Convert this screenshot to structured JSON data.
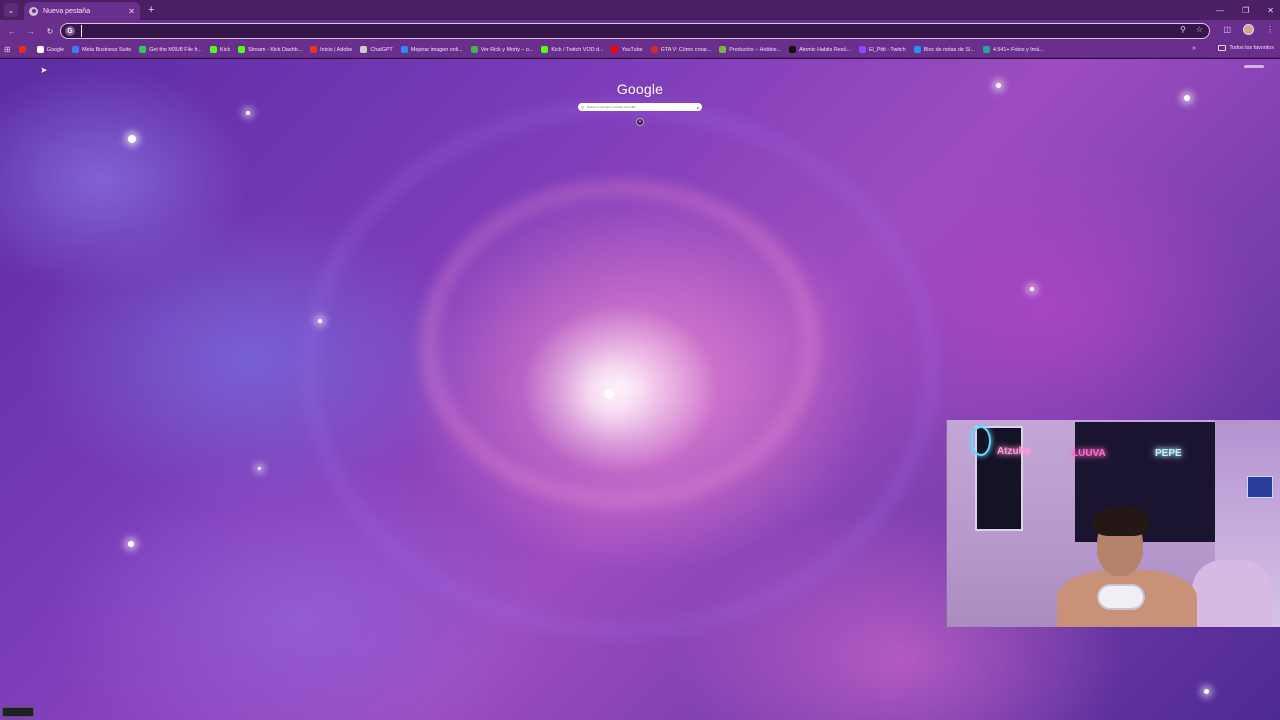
{
  "browser": {
    "tab": {
      "title": "Nueva pestaña",
      "favicon": "chrome-icon",
      "close_icon": "close-icon"
    },
    "new_tab_icon": "plus-icon",
    "tab_search_icon": "chevron-down-icon",
    "window_controls": [
      "minimize-icon",
      "restore-icon",
      "close-icon"
    ]
  },
  "toolbar": {
    "back_icon": "arrow-left-icon",
    "forward_icon": "arrow-right-icon",
    "reload_icon": "reload-icon",
    "omnibox": {
      "value": "",
      "placeholder": "",
      "site_icon": "google-g-icon"
    },
    "omnibox_right_icons": [
      "zoom-icon",
      "star-icon"
    ],
    "extensions_icon": "puzzle-icon",
    "menu_icon": "kebab-icon"
  },
  "bookmarks": {
    "apps_icon": "apps-grid-icon",
    "items": [
      {
        "label": "",
        "color": "#e52d27"
      },
      {
        "label": "Google",
        "color": "#ffffff"
      },
      {
        "label": "Meta Business Suite",
        "color": "#3b7bf6"
      },
      {
        "label": "Get the M3U8 File fr...",
        "color": "#34c759"
      },
      {
        "label": "Kick",
        "color": "#53fc18"
      },
      {
        "label": "Stream - Kick Dashb...",
        "color": "#53fc18"
      },
      {
        "label": "Inicio | Adobe",
        "color": "#e8352a"
      },
      {
        "label": "ChatGPT",
        "color": "#cccccc"
      },
      {
        "label": "Mejorar imagen onli...",
        "color": "#2d8cf0"
      },
      {
        "label": "Ver Rick y Morty – o...",
        "color": "#4caf50"
      },
      {
        "label": "Kick / Twitch VOD d...",
        "color": "#53fc18"
      },
      {
        "label": "YouTube",
        "color": "#ff0000"
      },
      {
        "label": "GTA V: Cómo crear...",
        "color": "#d22b2b"
      },
      {
        "label": "Productos – Hobbie...",
        "color": "#7cb342"
      },
      {
        "label": "Atomic Habits Resú...",
        "color": "#111111"
      },
      {
        "label": "El_Pitti - Twitch",
        "color": "#9146ff"
      },
      {
        "label": "Bloc de notas de Sí...",
        "color": "#2196f3"
      },
      {
        "label": "4.541+ Fotos y Imá...",
        "color": "#26a69a"
      }
    ],
    "overflow_icon": "double-chevron-right-icon",
    "all_bookmarks": "Todos los favoritos"
  },
  "ntp": {
    "logo": "Google",
    "search_placeholder": "Busca en Google o escribe una URL",
    "search_icon": "search-icon",
    "voice_icon": "mic-icon",
    "shortcut_icon": "plus-icon"
  },
  "webcam": {
    "neon_left": "Atzuha",
    "neon_mid": "LUUVA",
    "neon_right": "PEPE"
  }
}
